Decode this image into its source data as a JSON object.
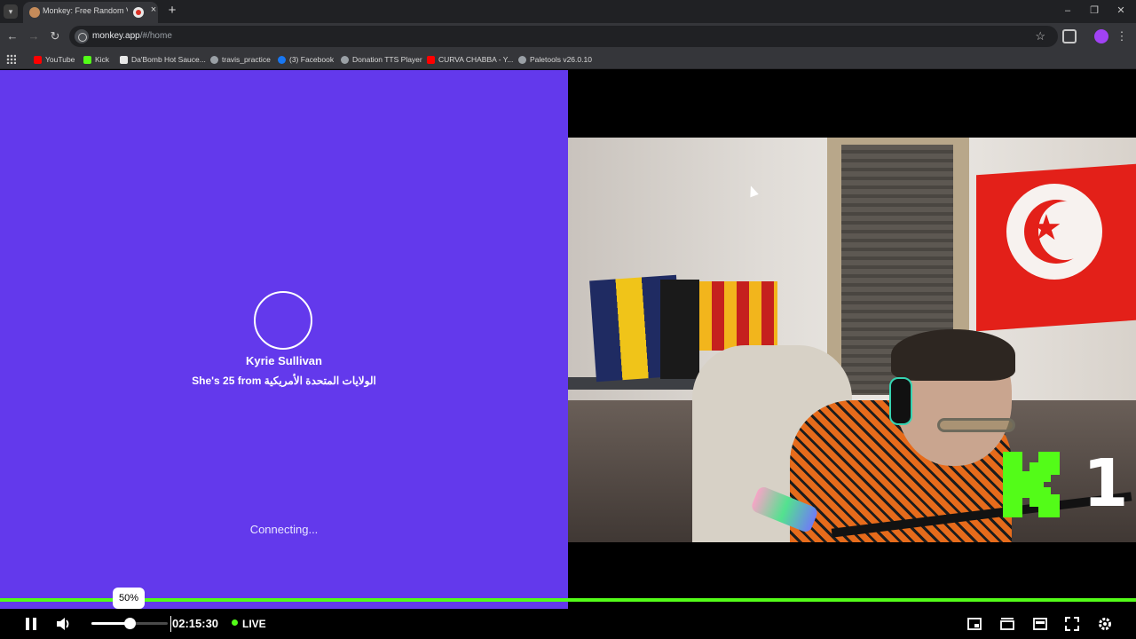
{
  "browser": {
    "tab_title": "Monkey: Free Random Vide",
    "tab_close": "×",
    "new_tab": "+",
    "url_host": "monkey.app",
    "url_path": "/#/home",
    "bookmarks": [
      {
        "label": "YouTube",
        "color": "#ff0000"
      },
      {
        "label": "Kick",
        "color": "#53fc18"
      },
      {
        "label": "Da'Bomb Hot Sauce...",
        "color": "#e8e8e8"
      },
      {
        "label": "travis_practice",
        "color": "#9aa0a6"
      },
      {
        "label": "(3) Facebook",
        "color": "#1877f2"
      },
      {
        "label": "Donation TTS Player",
        "color": "#9aa0a6"
      },
      {
        "label": "CURVA CHABBA - Y...",
        "color": "#ff0000"
      },
      {
        "label": "Paletools v26.0.10",
        "color": "#9aa0a6"
      }
    ]
  },
  "monkey": {
    "background_color": "#6339ec",
    "match_name": "Kyrie Sullivan",
    "match_info": "She's 25 from الولايات المتحدة الأمريكية",
    "status": "Connecting..."
  },
  "overlay": {
    "kick_number": "1",
    "kick_color": "#53fc18"
  },
  "player": {
    "volume_tooltip": "50%",
    "volume_level": 0.5,
    "time": "02:15:30",
    "live_label": "LIVE",
    "accent_color": "#53fc18"
  }
}
